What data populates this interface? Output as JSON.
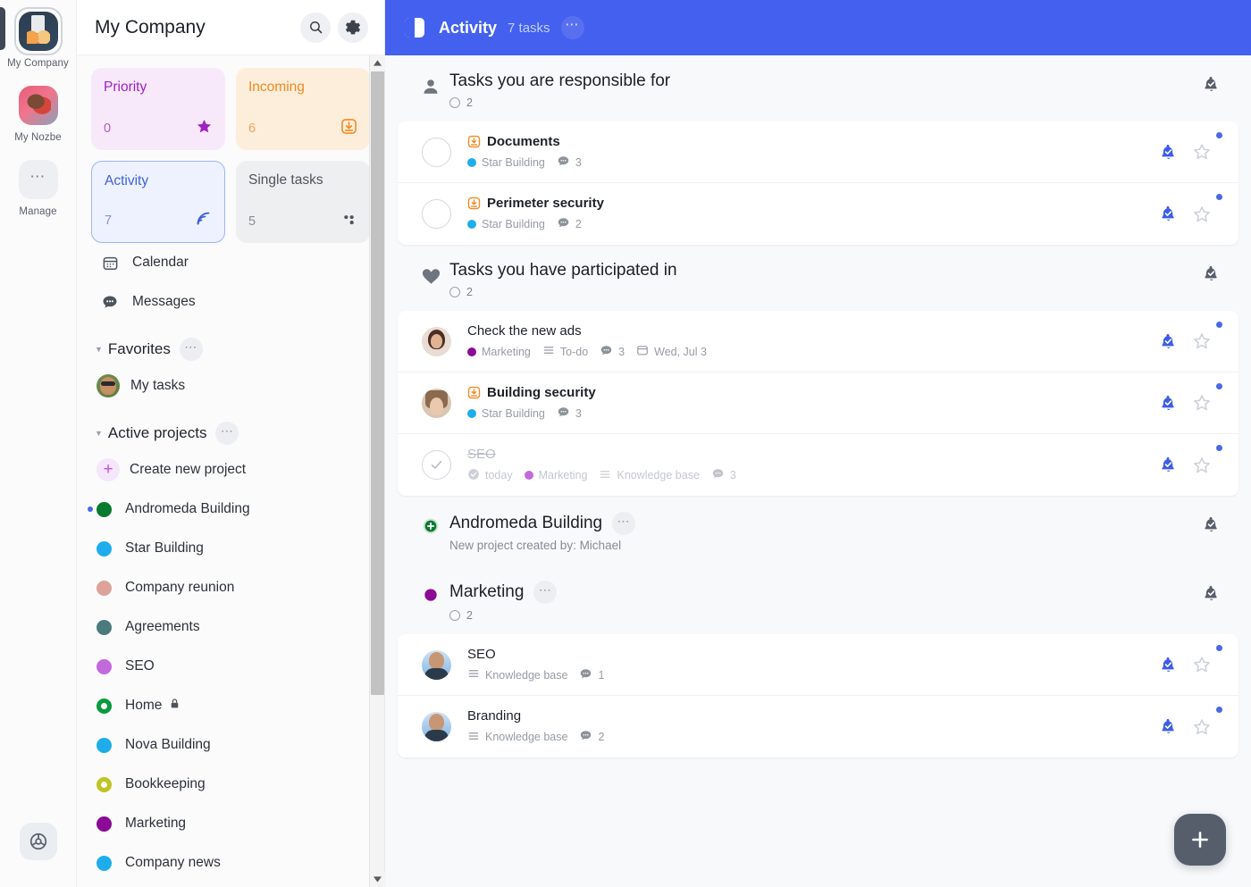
{
  "rail": {
    "items": [
      {
        "label": "My Company",
        "icon": "company-avatar",
        "selected": true
      },
      {
        "label": "My Nozbe",
        "icon": "nozbe-avatar",
        "selected": false
      },
      {
        "label": "Manage",
        "icon": "ellipsis-icon",
        "selected": false
      }
    ],
    "accessibility_icon": "accessibility-icon"
  },
  "sidebar": {
    "title": "My Company",
    "search_icon": "search-icon",
    "settings_icon": "gear-icon",
    "tiles": [
      {
        "name": "Priority",
        "count": "0",
        "icon": "star-icon",
        "key": "priority",
        "selected": false
      },
      {
        "name": "Incoming",
        "count": "6",
        "icon": "inbox-icon",
        "key": "incoming",
        "selected": false
      },
      {
        "name": "Activity",
        "count": "7",
        "icon": "activity-icon",
        "key": "activity",
        "selected": true
      },
      {
        "name": "Single tasks",
        "count": "5",
        "icon": "dots-icon",
        "key": "single",
        "selected": false
      }
    ],
    "nav": [
      {
        "label": "Calendar",
        "icon": "calendar-icon"
      },
      {
        "label": "Messages",
        "icon": "messages-icon"
      }
    ],
    "favorites": {
      "title": "Favorites",
      "menu_icon": "ellipsis-icon",
      "items": [
        {
          "label": "My tasks",
          "icon": "user-avatar"
        }
      ]
    },
    "active_projects": {
      "title": "Active projects",
      "menu_icon": "ellipsis-icon",
      "create_label": "Create new project",
      "create_icon": "plus-icon",
      "items": [
        {
          "label": "Andromeda Building",
          "color": "#0a7a2f",
          "hollow": false,
          "unread": true,
          "locked": false
        },
        {
          "label": "Star Building",
          "color": "#1eadea",
          "hollow": false,
          "unread": false,
          "locked": false
        },
        {
          "label": "Company reunion",
          "color": "#dda29a",
          "hollow": false,
          "unread": false,
          "locked": false
        },
        {
          "label": "Agreements",
          "color": "#4a7b7e",
          "hollow": false,
          "unread": false,
          "locked": false
        },
        {
          "label": "SEO",
          "color": "#c269dc",
          "hollow": false,
          "unread": false,
          "locked": false
        },
        {
          "label": "Home",
          "color": "#0a9a3e",
          "hollow": true,
          "unread": false,
          "locked": true
        },
        {
          "label": "Nova Building",
          "color": "#1eadea",
          "hollow": false,
          "unread": false,
          "locked": false
        },
        {
          "label": "Bookkeeping",
          "color": "#bfc424",
          "hollow": true,
          "unread": false,
          "locked": false
        },
        {
          "label": "Marketing",
          "color": "#8b0a96",
          "hollow": false,
          "unread": false,
          "locked": false
        },
        {
          "label": "Company news",
          "color": "#1eadea",
          "hollow": false,
          "unread": false,
          "locked": false
        }
      ]
    },
    "scrollbar": {
      "up_icon": "caret-up-icon",
      "down_icon": "caret-down-icon"
    }
  },
  "main": {
    "header": {
      "panel_toggle_icon": "panel-toggle-icon",
      "title": "Activity",
      "subtitle": "7 tasks",
      "menu_icon": "ellipsis-icon"
    },
    "sections": [
      {
        "id": "responsible",
        "icon": "person-icon",
        "title": "Tasks you are responsible for",
        "count": "2",
        "has_count": true,
        "menu": false,
        "subtitle": null,
        "right_icon": "bell-check-icon",
        "tasks": [
          {
            "lead": "checkbox",
            "title": "Documents",
            "bold": true,
            "done": false,
            "prefix_icon": "inbox-icon",
            "meta": [
              {
                "type": "project",
                "label": "Star Building",
                "color": "#1eadea"
              },
              {
                "type": "comments",
                "label": "3"
              }
            ],
            "bell_icon": "bell-check-icon",
            "star_icon": "star-outline-icon",
            "unread": true
          },
          {
            "lead": "checkbox",
            "title": "Perimeter security",
            "bold": true,
            "done": false,
            "prefix_icon": "inbox-icon",
            "meta": [
              {
                "type": "project",
                "label": "Star Building",
                "color": "#1eadea"
              },
              {
                "type": "comments",
                "label": "2"
              }
            ],
            "bell_icon": "bell-check-icon",
            "star_icon": "star-outline-icon",
            "unread": true
          }
        ]
      },
      {
        "id": "participated",
        "icon": "heart-icon",
        "title": "Tasks you have participated in",
        "count": "2",
        "has_count": true,
        "menu": false,
        "subtitle": null,
        "right_icon": "bell-check-icon",
        "tasks": [
          {
            "lead": "avatar",
            "avatar": "woman-1-avatar",
            "title": "Check the new ads",
            "bold": false,
            "done": false,
            "prefix_icon": null,
            "meta": [
              {
                "type": "project",
                "label": "Marketing",
                "color": "#8b0a96"
              },
              {
                "type": "section",
                "label": "To-do"
              },
              {
                "type": "comments",
                "label": "3"
              },
              {
                "type": "date",
                "label": "Wed, Jul 3"
              }
            ],
            "bell_icon": "bell-check-icon",
            "star_icon": "star-outline-icon",
            "unread": true
          },
          {
            "lead": "avatar",
            "avatar": "woman-2-avatar",
            "title": "Building security",
            "bold": true,
            "done": false,
            "prefix_icon": "inbox-icon",
            "meta": [
              {
                "type": "project",
                "label": "Star Building",
                "color": "#1eadea"
              },
              {
                "type": "comments",
                "label": "3"
              }
            ],
            "bell_icon": "bell-check-icon",
            "star_icon": "star-outline-icon",
            "unread": true
          },
          {
            "lead": "checked",
            "title": "SEO",
            "bold": false,
            "done": true,
            "prefix_icon": null,
            "meta": [
              {
                "type": "completed",
                "label": "today"
              },
              {
                "type": "project",
                "label": "Marketing",
                "color": "#c269dc"
              },
              {
                "type": "section",
                "label": "Knowledge base"
              },
              {
                "type": "comments",
                "label": "3"
              }
            ],
            "bell_icon": "bell-check-icon",
            "star_icon": "star-outline-icon",
            "unread": true
          }
        ]
      },
      {
        "id": "andromeda",
        "icon": "project-plus-icon",
        "icon_color": "#0a7a2f",
        "title": "Andromeda Building",
        "count": null,
        "has_count": false,
        "menu": true,
        "menu_icon": "ellipsis-icon",
        "subtitle": "New project created by: Michael",
        "right_icon": "bell-check-icon",
        "tasks": []
      },
      {
        "id": "marketing",
        "icon": "project-dot-icon",
        "icon_color": "#8b0a96",
        "title": "Marketing",
        "count": "2",
        "has_count": true,
        "menu": true,
        "menu_icon": "ellipsis-icon",
        "subtitle": null,
        "right_icon": "bell-check-icon",
        "tasks": [
          {
            "lead": "avatar",
            "avatar": "man-1-avatar",
            "title": "SEO",
            "bold": false,
            "done": false,
            "prefix_icon": null,
            "meta": [
              {
                "type": "section",
                "label": "Knowledge base"
              },
              {
                "type": "comments",
                "label": "1"
              }
            ],
            "bell_icon": "bell-check-icon",
            "star_icon": "star-outline-icon",
            "unread": true
          },
          {
            "lead": "avatar",
            "avatar": "man-1-avatar",
            "title": "Branding",
            "bold": false,
            "done": false,
            "prefix_icon": null,
            "meta": [
              {
                "type": "section",
                "label": "Knowledge base"
              },
              {
                "type": "comments",
                "label": "2"
              }
            ],
            "bell_icon": "bell-check-icon",
            "star_icon": "star-outline-icon",
            "unread": true
          }
        ]
      }
    ],
    "fab": {
      "icon": "plus-icon",
      "label": "+"
    }
  },
  "colors": {
    "header_blue": "#4361ee",
    "accent_blue": "#4868e8",
    "bg": "#f8f9fb"
  }
}
